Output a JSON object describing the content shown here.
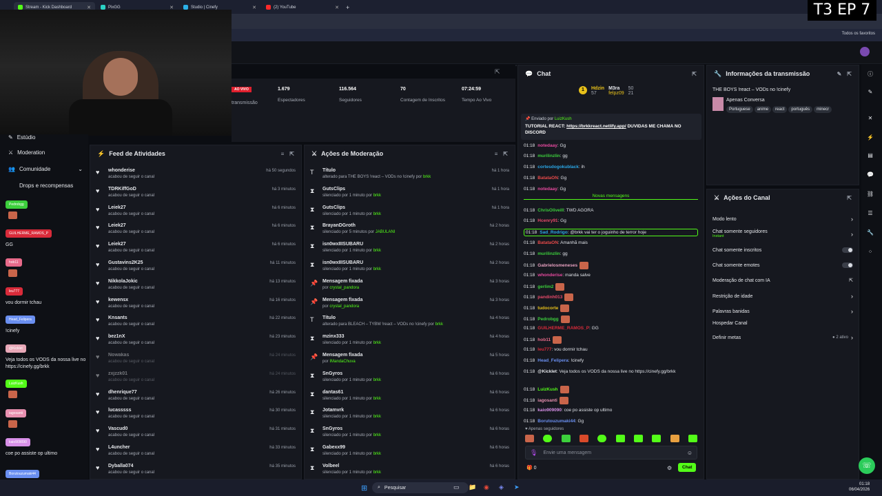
{
  "browser": {
    "tabs": [
      {
        "label": "Stream - Kick Dashboard",
        "color": "#53fc18"
      },
      {
        "label": "PixGG",
        "color": "#2bd1c4"
      },
      {
        "label": "Studio | Cinefy",
        "color": "#2bb0e8"
      },
      {
        "label": "(2) YouTube",
        "color": "#ff2a2a"
      }
    ],
    "new_tab": "+",
    "bookmark_folder": "Todos os favoritos"
  },
  "overlay": {
    "episode": "T3 EP 7"
  },
  "leftnav": {
    "items": [
      {
        "label": "Estúdio"
      },
      {
        "label": "Moderation"
      },
      {
        "label": "Comunidade"
      },
      {
        "label": "Drops e recompensas"
      }
    ]
  },
  "chat_overlay": [
    {
      "user": "Pedrobgg",
      "color": "#3ccf3c",
      "text": ""
    },
    {
      "user": "GUILHERME_RAMOS_P",
      "color": "#d92b3a",
      "text": "GG"
    },
    {
      "user": "hob11",
      "color": "#e86a8a",
      "text": ""
    },
    {
      "user": "leu777",
      "color": "#d92b3a",
      "text": "vou dormir tchau"
    },
    {
      "user": "Head_Felipera",
      "color": "#6a8ff0",
      "text": "!cinefy"
    },
    {
      "user": "@Kicklet",
      "color": "#e8a8b8",
      "text": "Veja todos os VODS da nossa live no https://cinefy.gg/brkk"
    },
    {
      "user": "LuizKush",
      "color": "#53fc18",
      "text": ""
    },
    {
      "user": "iagosanti",
      "color": "#e890b0",
      "text": ""
    },
    {
      "user": "kaio909090",
      "color": "#d890e8",
      "text": "coe po assiste op ultimo"
    },
    {
      "user": "Borutouzumaki44",
      "color": "#6a8ff0",
      "text": "Gg"
    }
  ],
  "stats": {
    "live_badge": "AO VIVO",
    "transmission_label": "transmissão",
    "items": [
      {
        "value": "1.679",
        "label": "Espectadores"
      },
      {
        "value": "116.564",
        "label": "Seguidores"
      },
      {
        "value": "70",
        "label": "Contagem de Inscritos"
      },
      {
        "value": "07:24:59",
        "label": "Tempo Ao Vivo"
      }
    ]
  },
  "feed": {
    "title": "Feed de Atividades",
    "items": [
      {
        "name": "whonderise",
        "sub": "acabou de seguir o canal",
        "time": "há 50 segundos"
      },
      {
        "name": "TDRKiffGoD",
        "sub": "acabou de seguir o canal",
        "time": "há 3 minutos"
      },
      {
        "name": "Leiek27",
        "sub": "acabou de seguir o canal",
        "time": "há 6 minutos"
      },
      {
        "name": "Leiek27",
        "sub": "acabou de seguir o canal",
        "time": "há 6 minutos"
      },
      {
        "name": "Leiek27",
        "sub": "acabou de seguir o canal",
        "time": "há 6 minutos"
      },
      {
        "name": "Gustavins2K25",
        "sub": "acabou de seguir o canal",
        "time": "há 11 minutos"
      },
      {
        "name": "NikkolaJokic",
        "sub": "acabou de seguir o canal",
        "time": "há 13 minutos"
      },
      {
        "name": "kewensx",
        "sub": "acabou de seguir o canal",
        "time": "há 16 minutos"
      },
      {
        "name": "Knsants",
        "sub": "acabou de seguir o canal",
        "time": "há 22 minutos"
      },
      {
        "name": "bez1nX",
        "sub": "acabou de seguir o canal",
        "time": "há 23 minutos"
      },
      {
        "name": "Nowakas",
        "sub": "acabou de seguir o canal",
        "time": "há 24 minutos"
      },
      {
        "name": "zxjzzk01",
        "sub": "acabou de seguir o canal",
        "time": "há 24 minutos"
      },
      {
        "name": "dhenrique77",
        "sub": "acabou de seguir o canal",
        "time": "há 26 minutos"
      },
      {
        "name": "lucasssss",
        "sub": "acabou de seguir o canal",
        "time": "há 30 minutos"
      },
      {
        "name": "Vascud0",
        "sub": "acabou de seguir o canal",
        "time": "há 31 minutos"
      },
      {
        "name": "L4uncher",
        "sub": "acabou de seguir o canal",
        "time": "há 33 minutos"
      },
      {
        "name": "Dyballa074",
        "sub": "acabou de seguir o canal",
        "time": "há 35 minutos"
      }
    ]
  },
  "moderation": {
    "title": "Ações de Moderação",
    "items": [
      {
        "icon": "T",
        "name": "Título",
        "sub": "alterado para THE BOYS !react – VODs no !cinefy",
        "by": "brkk",
        "time": "há 1 hora"
      },
      {
        "icon": "⧗",
        "name": "GutsClips",
        "sub": "silenciado por 1 minuto",
        "by": "brkk",
        "time": "há 1 hora"
      },
      {
        "icon": "⧗",
        "name": "GutsClips",
        "sub": "silenciado por 1 minuto",
        "by": "brkk",
        "time": "há 1 hora"
      },
      {
        "icon": "⧗",
        "name": "BrayanDGroth",
        "sub": "silenciado por 5 minutos",
        "by": "JABULANI",
        "time": "há 2 horas"
      },
      {
        "icon": "⧗",
        "name": "isn0wxIIISUBARU",
        "sub": "silenciado por 1 minuto",
        "by": "brkk",
        "time": "há 2 horas"
      },
      {
        "icon": "⧗",
        "name": "isn0wxIIISUBARU",
        "sub": "silenciado por 1 minuto",
        "by": "brkk",
        "time": "há 2 horas"
      },
      {
        "icon": "📌",
        "name": "Mensagem fixada",
        "sub": "",
        "by": "crystal_pandora",
        "time": "há 3 horas"
      },
      {
        "icon": "📌",
        "name": "Mensagem fixada",
        "sub": "",
        "by": "crystal_pandora",
        "time": "há 3 horas"
      },
      {
        "icon": "T",
        "name": "Título",
        "sub": "alterado para BLEACH – TYBW !react – VODs no !cinefy",
        "by": "brkk",
        "time": "há 4 horas"
      },
      {
        "icon": "⧗",
        "name": "mzinx333",
        "sub": "silenciado por 1 minuto",
        "by": "brkk",
        "time": "há 4 horas"
      },
      {
        "icon": "📌",
        "name": "Mensagem fixada",
        "sub": "",
        "by": "IMandaChuva",
        "time": "há 5 horas"
      },
      {
        "icon": "⧗",
        "name": "SnGyros",
        "sub": "silenciado por 1 minuto",
        "by": "brkk",
        "time": "há 6 horas"
      },
      {
        "icon": "⧗",
        "name": "dantas61",
        "sub": "silenciado por 1 minuto",
        "by": "brkk",
        "time": "há 6 horas"
      },
      {
        "icon": "⧗",
        "name": "Jotamvrk",
        "sub": "silenciado por 1 minuto",
        "by": "brkk",
        "time": "há 6 horas"
      },
      {
        "icon": "⧗",
        "name": "SnGyros",
        "sub": "silenciado por 1 minuto",
        "by": "brkk",
        "time": "há 6 horas"
      },
      {
        "icon": "⧗",
        "name": "Gabexx99",
        "sub": "silenciado por 1 minuto",
        "by": "brkk",
        "time": "há 6 horas"
      },
      {
        "icon": "⧗",
        "name": "Volbeel",
        "sub": "silenciado por 1 minuto",
        "by": "brkk",
        "time": "há 6 horas"
      }
    ],
    "by_word": "por"
  },
  "chat": {
    "title": "Chat",
    "leaders": [
      {
        "rank": "1",
        "name": "Hdzin",
        "value": "57"
      },
      {
        "rank": "",
        "name": "M3ra",
        "value": "50"
      },
      {
        "rank": "",
        "name": "felpz09",
        "value": "21"
      }
    ],
    "pinned_by": "Enviado por",
    "pinned_user": "LuizKush",
    "pinned_text": "TUTORIAL REACT:",
    "pinned_link": "https://brkkreact.netlify.app/",
    "pinned_rest": "DUVIDAS ME CHAMA NO DISCORD",
    "new_messages": "Novas mensagens",
    "messages": [
      {
        "time": "01:18",
        "user": "notedaay",
        "color": "#e84aa0",
        "text": "Gg"
      },
      {
        "time": "01:18",
        "user": "murilinzlin",
        "color": "#3ccf3c",
        "text": "gg"
      },
      {
        "time": "01:18",
        "user": "cortesdogokublack",
        "color": "#2ba8e8",
        "text": "ih"
      },
      {
        "time": "01:18",
        "user": "BatataON",
        "color": "#e84a4a",
        "text": "Gg"
      },
      {
        "time": "01:18",
        "user": "notedaay",
        "color": "#e84aa0",
        "text": "Gg"
      },
      {
        "time": "01:18",
        "user": "ChrisOliveiII",
        "color": "#3ccf3c",
        "text": "TWD AGORA"
      },
      {
        "time": "01:18",
        "user": "Hcenry91",
        "color": "#e84a6a",
        "text": "Gg"
      },
      {
        "time": "01:18",
        "user": "Sad_Rodrigo",
        "color": "#2ba8e8",
        "text": "@brkk vai ter o joguinho de terror hoje"
      },
      {
        "time": "01:18",
        "user": "BatataON",
        "color": "#e84a4a",
        "text": "Amanhã mais"
      },
      {
        "time": "01:18",
        "user": "murilinzlin",
        "color": "#3ccf3c",
        "text": "gg"
      },
      {
        "time": "01:18",
        "user": "Gabrielosmeneses",
        "color": "#e8a0c0",
        "text": ""
      },
      {
        "time": "01:18",
        "user": "whonderise",
        "color": "#e84aa0",
        "text": "manda salve"
      },
      {
        "time": "01:18",
        "user": "gerlim2",
        "color": "#3ccf3c",
        "text": ""
      },
      {
        "time": "01:18",
        "user": "pandinh013",
        "color": "#e84a6a",
        "text": ""
      },
      {
        "time": "01:18",
        "user": "tudocorte",
        "color": "#e8c11a",
        "text": ""
      },
      {
        "time": "01:18",
        "user": "Pedrobgg",
        "color": "#3ccf3c",
        "text": ""
      },
      {
        "time": "01:18",
        "user": "GUILHERME_RAMOS_P",
        "color": "#d92b3a",
        "text": "GG"
      },
      {
        "time": "01:18",
        "user": "hob11",
        "color": "#e86a8a",
        "text": ""
      },
      {
        "time": "01:18",
        "user": "leu777",
        "color": "#d92b3a",
        "text": "vou dormir tchau"
      },
      {
        "time": "01:18",
        "user": "Head_Felipera",
        "color": "#6a8ff0",
        "text": "!cinefy"
      },
      {
        "time": "01:18",
        "user": "@Kicklet",
        "color": "#e6e8ec",
        "text": "Veja todos os VODS da nossa live no https://cinefy.gg/brkk"
      },
      {
        "time": "01:18",
        "user": "LuizKush",
        "color": "#53fc18",
        "text": ""
      },
      {
        "time": "01:18",
        "user": "iagosanti",
        "color": "#e890b0",
        "text": ""
      },
      {
        "time": "01:18",
        "user": "kaio909090",
        "color": "#d890e8",
        "text": "coe po assiste op ultimo"
      },
      {
        "time": "01:18",
        "user": "Borutouzumaki44",
        "color": "#6a8ff0",
        "text": "Gg"
      }
    ],
    "followers_only": "Apenas seguidores",
    "input_placeholder": "Envie uma mensagem",
    "count": "0",
    "send_label": "Chat"
  },
  "info": {
    "title": "Informações da transmissão",
    "stream_title": "THE BOYS !react – VODs no !cinefy",
    "category": "Apenas Conversa",
    "tags": [
      "Portuguese",
      "anime",
      "react",
      "português",
      "minecr"
    ]
  },
  "actions": {
    "title": "Ações do Canal",
    "items": [
      {
        "label": "Modo lento",
        "sub": "",
        "right": "chevron"
      },
      {
        "label": "Chat somente seguidores",
        "sub": "Instant",
        "right": "chevron"
      },
      {
        "label": "Chat somente inscritos",
        "sub": "",
        "right": "toggle"
      },
      {
        "label": "Chat somente emotes",
        "sub": "",
        "right": "toggle"
      },
      {
        "label": "Moderação de chat com IA",
        "sub": "",
        "right": "external"
      },
      {
        "label": "Restrição de idade",
        "sub": "",
        "right": "chevron"
      },
      {
        "label": "Palavras banidas",
        "sub": "",
        "right": "chevron"
      },
      {
        "label": "Hospedar Canal",
        "sub": "",
        "right": ""
      },
      {
        "label": "Definir metas",
        "sub": "",
        "right": "chevron",
        "badge": "2 ativo"
      }
    ]
  },
  "taskbar": {
    "search": "Pesquisar",
    "time": "01:18",
    "date": "06/04/2026"
  },
  "colors": {
    "accent": "#53fc18",
    "panel": "#16181f",
    "bg": "#0b0d12"
  }
}
